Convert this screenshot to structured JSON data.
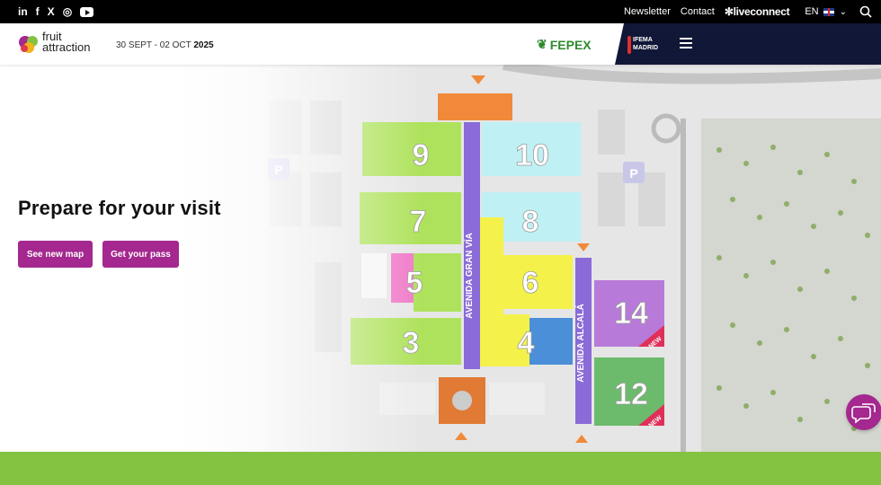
{
  "topbar": {
    "social": [
      "in",
      "f",
      "X",
      "◎"
    ],
    "newsletter": "Newsletter",
    "contact": "Contact",
    "liveconnect": "liveconnect",
    "language": "EN"
  },
  "header": {
    "logo_line1": "fruit",
    "logo_line2": "attraction",
    "dates_prefix": "30 SEPT - 02 OCT",
    "dates_year": "2025",
    "fepex": "FEPEX",
    "ifema_line1": "IFEMA",
    "ifema_line2": "MADRID"
  },
  "hero": {
    "title": "Prepare for your visit",
    "button_map": "See new map",
    "button_pass": "Get your pass"
  },
  "map": {
    "halls": [
      "9",
      "10",
      "7",
      "8",
      "5",
      "6",
      "14",
      "3",
      "4",
      "12"
    ],
    "avenue_gran_via": "AVENIDA GRAN VÍA",
    "avenue_alcala": "AVENIDA ALCALÁ",
    "parking": "P",
    "new_badge": "NEW"
  },
  "colors": {
    "accent": "#a4288f",
    "green": "#84c341",
    "navy": "#111737"
  }
}
